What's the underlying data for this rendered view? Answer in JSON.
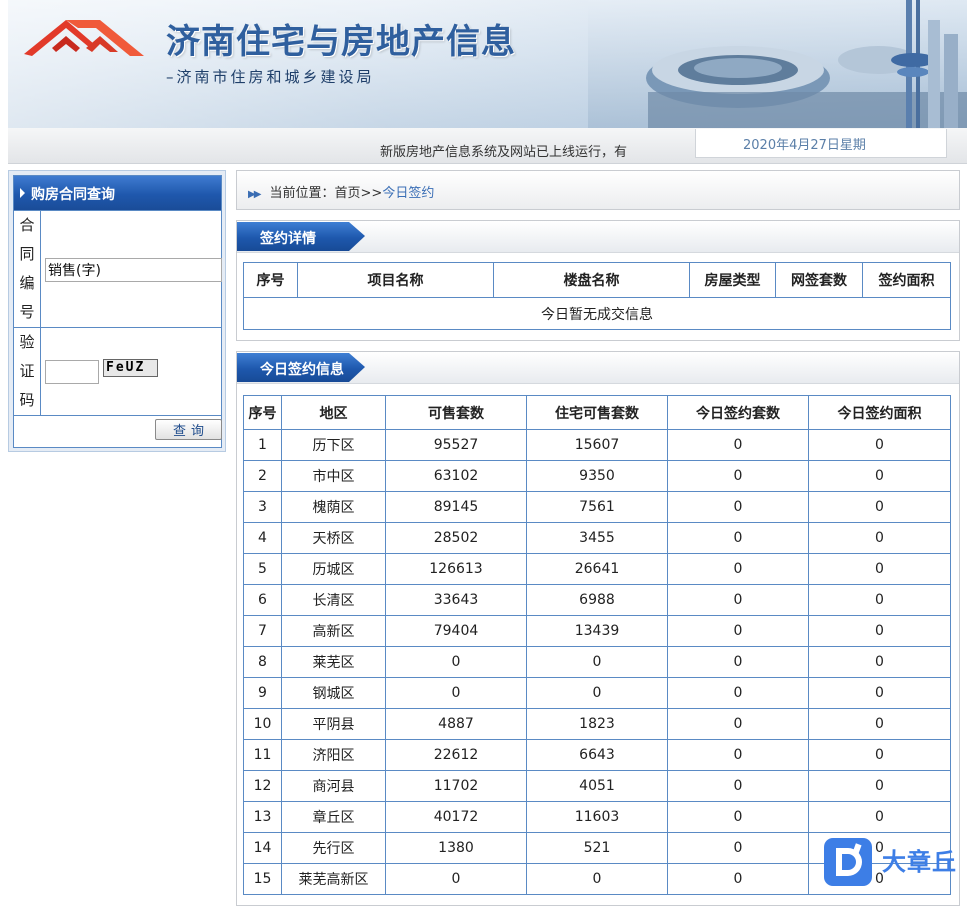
{
  "banner": {
    "title": "济南住宅与房地产信息",
    "subtitle": "–济南市住房和城乡建设局"
  },
  "notice": {
    "marquee_text": "新版房地产信息系统及网站已上线运行，有",
    "date_text": "2020年4月27日星期"
  },
  "contract_query": {
    "header": "购房合同查询",
    "contract_label_chars": [
      "合",
      "同",
      "编",
      "号"
    ],
    "contract_input_value": "销售(字)",
    "captcha_label_chars": [
      "验",
      "证",
      "码"
    ],
    "captcha_input_value": "",
    "captcha_code": "FeUZ",
    "query_button": "查询"
  },
  "breadcrumb": {
    "prefix": "当前位置：首页>>",
    "current": "今日签约"
  },
  "sign_detail": {
    "tab": "签约详情",
    "columns": [
      "序号",
      "项目名称",
      "楼盘名称",
      "房屋类型",
      "网签套数",
      "签约面积"
    ],
    "empty_message": "今日暂无成交信息"
  },
  "today_sign": {
    "tab": "今日签约信息",
    "columns": [
      "序号",
      "地区",
      "可售套数",
      "住宅可售套数",
      "今日签约套数",
      "今日签约面积"
    ],
    "rows": [
      [
        "1",
        "历下区",
        "95527",
        "15607",
        "0",
        "0"
      ],
      [
        "2",
        "市中区",
        "63102",
        "9350",
        "0",
        "0"
      ],
      [
        "3",
        "槐荫区",
        "89145",
        "7561",
        "0",
        "0"
      ],
      [
        "4",
        "天桥区",
        "28502",
        "3455",
        "0",
        "0"
      ],
      [
        "5",
        "历城区",
        "126613",
        "26641",
        "0",
        "0"
      ],
      [
        "6",
        "长清区",
        "33643",
        "6988",
        "0",
        "0"
      ],
      [
        "7",
        "高新区",
        "79404",
        "13439",
        "0",
        "0"
      ],
      [
        "8",
        "莱芜区",
        "0",
        "0",
        "0",
        "0"
      ],
      [
        "9",
        "钢城区",
        "0",
        "0",
        "0",
        "0"
      ],
      [
        "10",
        "平阴县",
        "4887",
        "1823",
        "0",
        "0"
      ],
      [
        "11",
        "济阳区",
        "22612",
        "6643",
        "0",
        "0"
      ],
      [
        "12",
        "商河县",
        "11702",
        "4051",
        "0",
        "0"
      ],
      [
        "13",
        "章丘区",
        "40172",
        "11603",
        "0",
        "0"
      ],
      [
        "14",
        "先行区",
        "1380",
        "521",
        "0",
        "0"
      ],
      [
        "15",
        "莱芜高新区",
        "0",
        "0",
        "0",
        "0"
      ]
    ]
  },
  "watermark": {
    "logo_letter": "D",
    "text": "大章丘"
  }
}
